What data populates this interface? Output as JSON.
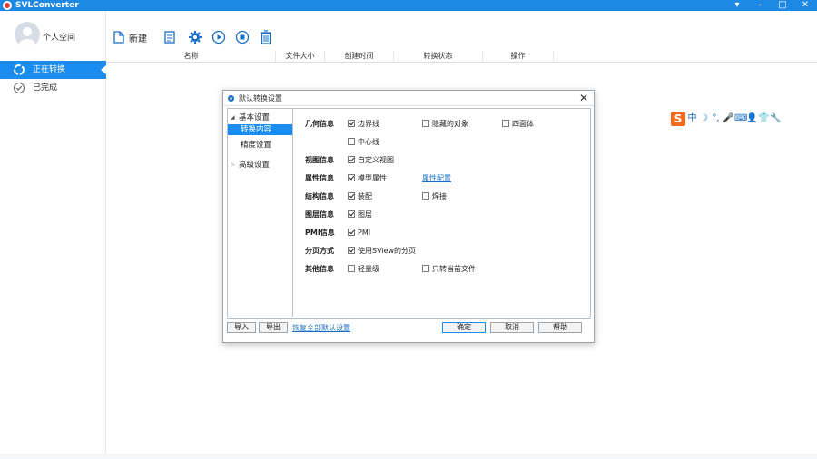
{
  "app": {
    "title": "SVLConverter"
  },
  "window_controls": {
    "menu": "▾",
    "minimize": "–",
    "maximize": "□",
    "close": "✕"
  },
  "profile": {
    "name": "个人空间"
  },
  "sidebar": {
    "items": [
      {
        "label": "正在转换",
        "active": true,
        "icon": "sync-icon"
      },
      {
        "label": "已完成",
        "active": false,
        "icon": "check-circle-icon"
      }
    ]
  },
  "toolbar": {
    "new_label": "新建",
    "buttons": [
      "new-file-icon",
      "document-icon",
      "gear-icon",
      "play-icon",
      "stop-icon",
      "trash-icon"
    ]
  },
  "grid": {
    "columns": [
      "名称",
      "文件大小",
      "创建时间",
      "转换状态",
      "操作"
    ]
  },
  "ime": {
    "logo": "S",
    "mode": "中",
    "items": [
      "☽",
      "°,",
      "🎤",
      "⌨",
      "👤",
      "👕",
      "🔧"
    ]
  },
  "dialog": {
    "title": "默认转换设置",
    "close": "✕",
    "tree": {
      "basic": "基本设置",
      "content": "转换内容",
      "precision": "精度设置",
      "advanced": "高级设置"
    },
    "rows": [
      {
        "label": "几何信息",
        "options": [
          {
            "text": "边界线",
            "checked": true
          },
          {
            "text": "隐藏的对象",
            "checked": false
          },
          {
            "text": "四面体",
            "checked": false
          },
          {
            "text": "中心线",
            "checked": false
          }
        ]
      },
      {
        "label": "视图信息",
        "options": [
          {
            "text": "自定义视图",
            "checked": true
          }
        ]
      },
      {
        "label": "属性信息",
        "options": [
          {
            "text": "模型属性",
            "checked": true
          }
        ],
        "link": "属性配置"
      },
      {
        "label": "结构信息",
        "options": [
          {
            "text": "装配",
            "checked": true
          },
          {
            "text": "焊接",
            "checked": false
          }
        ]
      },
      {
        "label": "图层信息",
        "options": [
          {
            "text": "图层",
            "checked": true
          }
        ]
      },
      {
        "label": "PMI信息",
        "options": [
          {
            "text": "PMI",
            "checked": true
          }
        ]
      },
      {
        "label": "分页方式",
        "options": [
          {
            "text": "使用SView的分页",
            "checked": true
          }
        ]
      },
      {
        "label": "其他信息",
        "options": [
          {
            "text": "轻量级",
            "checked": false
          },
          {
            "text": "只转当前文件",
            "checked": false
          }
        ]
      }
    ],
    "footer": {
      "import": "导入",
      "export": "导出",
      "restore_link": "恢复全部默认设置",
      "ok": "确定",
      "cancel": "取消",
      "help": "帮助"
    }
  },
  "colors": {
    "accent": "#1a8cf0",
    "titlebar": "#1e88e5",
    "ime_brand": "#f26a1b"
  }
}
